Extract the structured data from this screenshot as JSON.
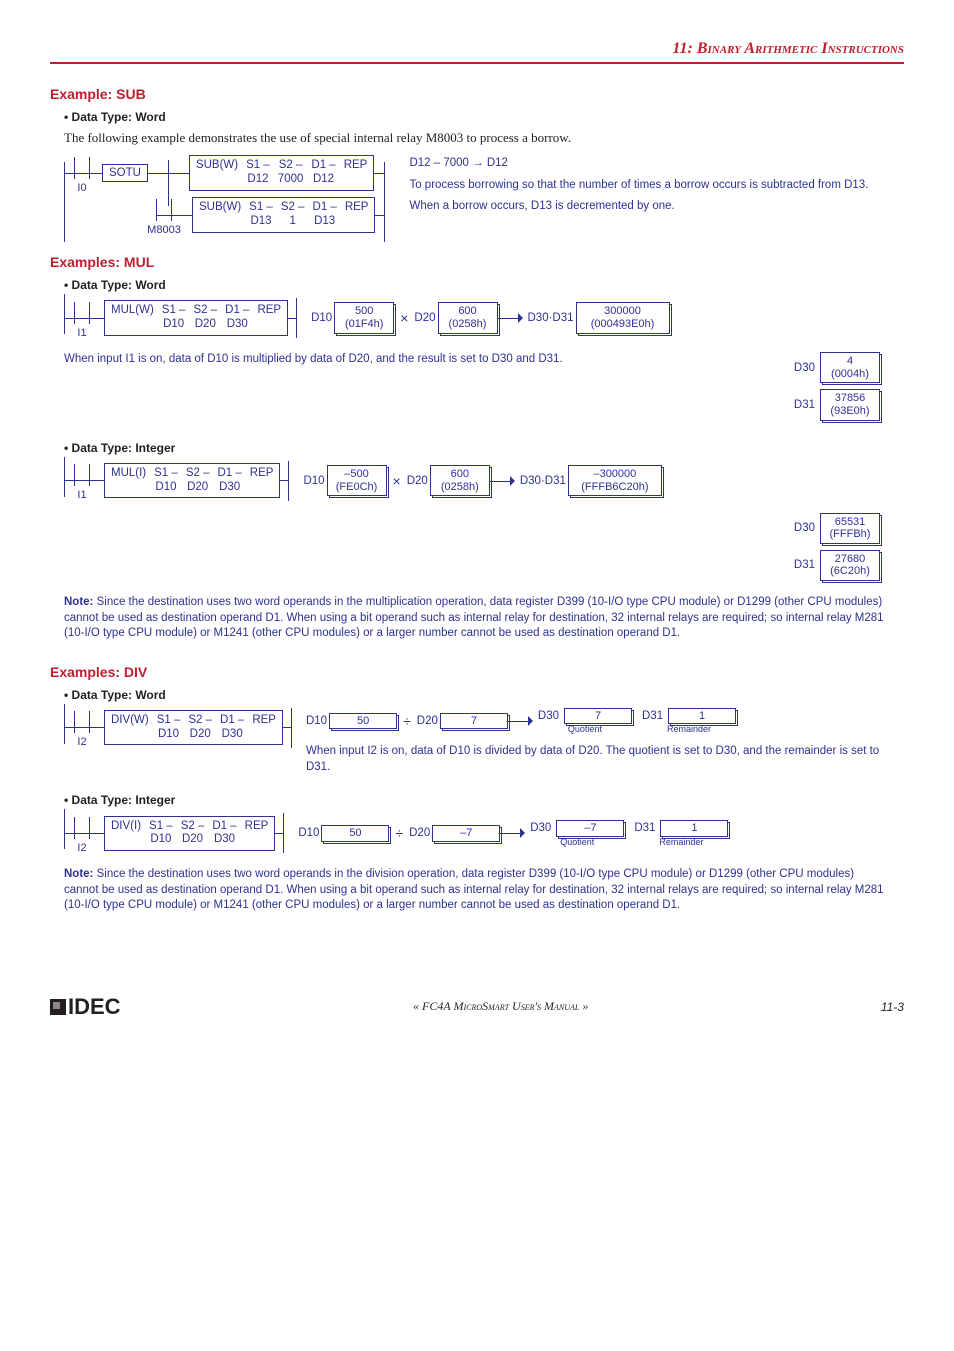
{
  "chapter": {
    "num": "11:",
    "title": "Binary Arithmetic Instructions"
  },
  "sub": {
    "heading": "Example: SUB",
    "dtype": "• Data Type: Word",
    "intro": "The following example demonstrates the use of special internal relay M8003 to process a borrow.",
    "i0": "I0",
    "sotu": "SOTU",
    "m8003": "M8003",
    "row1": {
      "op": "SUB(W)",
      "s1a": "S1 –",
      "s1b": "D12",
      "s2a": "S2 –",
      "s2b": "7000",
      "d1a": "D1 –",
      "d1b": "D12",
      "rep": "REP"
    },
    "row2": {
      "op": "SUB(W)",
      "s1a": "S1 –",
      "s1b": "D13",
      "s2a": "S2 –",
      "s2b": "1",
      "d1a": "D1 –",
      "d1b": "D13",
      "rep": "REP"
    },
    "rhs1": "D12 – 7000 → D12",
    "rhs2": "To process borrowing so that the number of times a borrow occurs is subtracted from D13.",
    "rhs3": "When a borrow occurs, D13 is decremented by one."
  },
  "mul": {
    "heading": "Examples: MUL",
    "w": {
      "dtype": "• Data Type: Word",
      "i1": "I1",
      "box": {
        "op": "MUL(W)",
        "s1a": "S1 –",
        "s1b": "D10",
        "s2a": "S2 –",
        "s2b": "D20",
        "d1a": "D1 –",
        "d1b": "D30",
        "rep": "REP"
      },
      "d10": "D10",
      "d10v": "500",
      "d10h": "(01F4h)",
      "x": "×",
      "d20": "D20",
      "d20v": "600",
      "d20h": "(0258h)",
      "res": "D30·D31",
      "resv": "300000",
      "resh": "(000493E0h)",
      "d30": "D30",
      "d30v": "4",
      "d30h": "(0004h)",
      "d31": "D31",
      "d31v": "37856",
      "d31h": "(93E0h)",
      "note": "When input I1 is on, data of D10 is multiplied by data of D20, and the result is set to D30 and D31."
    },
    "i": {
      "dtype": "• Data Type: Integer",
      "i1": "I1",
      "box": {
        "op": "MUL(I)",
        "s1a": "S1 –",
        "s1b": "D10",
        "s2a": "S2 –",
        "s2b": "D20",
        "d1a": "D1 –",
        "d1b": "D30",
        "rep": "REP"
      },
      "d10": "D10",
      "d10v": "–500",
      "d10h": "(FE0Ch)",
      "x": "×",
      "d20": "D20",
      "d20v": "600",
      "d20h": "(0258h)",
      "res": "D30·D31",
      "resv": "–300000",
      "resh": "(FFFB6C20h)",
      "d30": "D30",
      "d30v": "65531",
      "d30h": "(FFFBh)",
      "d31": "D31",
      "d31v": "27680",
      "d31h": "(6C20h)"
    },
    "note": "Since the destination uses two word operands in the multiplication operation, data register D399 (10-I/O type CPU module) or D1299 (other CPU modules) cannot be used as destination operand D1. When using a bit operand such as internal relay for destination, 32 internal relays are required; so internal relay M281 (10-I/O type CPU module) or M1241 (other CPU modules) or a larger number cannot be used as destination operand D1.",
    "noteLabel": "Note:"
  },
  "div": {
    "heading": "Examples: DIV",
    "w": {
      "dtype": "• Data Type: Word",
      "i2": "I2",
      "box": {
        "op": "DIV(W)",
        "s1a": "S1 –",
        "s1b": "D10",
        "s2a": "S2 –",
        "s2b": "D20",
        "d1a": "D1 –",
        "d1b": "D30",
        "rep": "REP"
      },
      "d10": "D10",
      "d10v": "50",
      "sym": "÷",
      "d20": "D20",
      "d20v": "7",
      "d30": "D30",
      "d30v": "7",
      "d30s": "Quotient",
      "d31": "D31",
      "d31v": "1",
      "d31s": "Remainder",
      "note": "When input I2 is on, data of D10 is divided by data of D20. The quotient is set to D30, and the remainder is set to D31."
    },
    "i": {
      "dtype": "• Data Type: Integer",
      "i2": "I2",
      "box": {
        "op": "DIV(I)",
        "s1a": "S1 –",
        "s1b": "D10",
        "s2a": "S2 –",
        "s2b": "D20",
        "d1a": "D1 –",
        "d1b": "D30",
        "rep": "REP"
      },
      "d10": "D10",
      "d10v": "50",
      "sym": "÷",
      "d20": "D20",
      "d20v": "–7",
      "d30": "D30",
      "d30v": "–7",
      "d30s": "Quotient",
      "d31": "D31",
      "d31v": "1",
      "d31s": "Remainder"
    },
    "note": "Since the destination uses two word operands in the division operation, data register D399 (10-I/O type CPU module) or D1299 (other CPU modules) cannot be used as destination operand D1. When using a bit operand such as internal relay for destination, 32 internal relays are required; so internal relay M281 (10-I/O type CPU module) or M1241 (other CPU modules) or a larger number cannot be used as destination operand D1.",
    "noteLabel": "Note:"
  },
  "footer": {
    "center": "« FC4A MicroSmart User's Manual »",
    "page": "11-3",
    "logo": "IDEC"
  }
}
